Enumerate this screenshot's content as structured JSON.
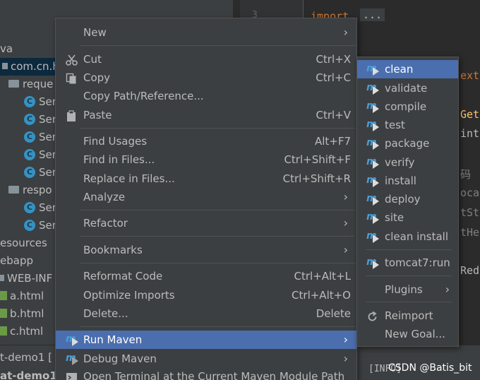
{
  "project_tree": [
    {
      "text": "va",
      "icon": "none"
    },
    {
      "text": "com.cn.h",
      "icon": "package-icon",
      "selected": true
    },
    {
      "text": "reque",
      "icon": "folder-icon"
    },
    {
      "text": "Ser",
      "icon": "class-icon"
    },
    {
      "text": "Ser",
      "icon": "class-icon"
    },
    {
      "text": "Ser",
      "icon": "class-icon"
    },
    {
      "text": "Ser",
      "icon": "class-icon"
    },
    {
      "text": "Ser",
      "icon": "class-icon"
    },
    {
      "text": "respo",
      "icon": "folder-icon"
    },
    {
      "text": "Ser",
      "icon": "class-icon"
    },
    {
      "text": "Ser",
      "icon": "class-icon"
    },
    {
      "text": "esources",
      "icon": "none"
    },
    {
      "text": "ebapp",
      "icon": "none"
    },
    {
      "text": "WEB-INF",
      "icon": "folder-icon"
    },
    {
      "text": "a.html",
      "icon": "html-icon"
    },
    {
      "text": "b.html",
      "icon": "html-icon"
    },
    {
      "text": "c.html",
      "icon": "html-icon"
    }
  ],
  "editor": {
    "line_number": "3",
    "import_kw": "import",
    "fold": "...",
    "fragments": [
      "ext",
      "Get",
      "int",
      "码",
      "oca",
      "tSt",
      "tHe",
      "Red"
    ]
  },
  "bottom": {
    "tab1": "t-demo1 [",
    "tab2": "at-demo1",
    "run_text": "[INFO]",
    "watermark": "CSDN @Batis_bit"
  },
  "context_menu": {
    "new": {
      "label": "New"
    },
    "cut": {
      "label": "Cut",
      "shortcut": "Ctrl+X"
    },
    "copy": {
      "label": "Copy",
      "shortcut": "Ctrl+C"
    },
    "copy_path": {
      "label": "Copy Path/Reference..."
    },
    "paste": {
      "label": "Paste",
      "shortcut": "Ctrl+V"
    },
    "find_usages": {
      "label": "Find Usages",
      "shortcut": "Alt+F7"
    },
    "find_in_files": {
      "label": "Find in Files...",
      "shortcut": "Ctrl+Shift+F"
    },
    "replace_in_files": {
      "label": "Replace in Files...",
      "shortcut": "Ctrl+Shift+R"
    },
    "analyze": {
      "label": "Analyze"
    },
    "refactor": {
      "label": "Refactor"
    },
    "bookmarks": {
      "label": "Bookmarks"
    },
    "reformat": {
      "label": "Reformat Code",
      "shortcut": "Ctrl+Alt+L"
    },
    "optimize": {
      "label": "Optimize Imports",
      "shortcut": "Ctrl+Alt+O"
    },
    "delete": {
      "label": "Delete...",
      "shortcut": "Delete"
    },
    "run_maven": {
      "label": "Run Maven"
    },
    "debug_maven": {
      "label": "Debug Maven"
    },
    "open_terminal": {
      "label": "Open Terminal at the Current Maven Module Path"
    }
  },
  "submenu": {
    "goals": [
      "clean",
      "validate",
      "compile",
      "test",
      "package",
      "verify",
      "install",
      "deploy",
      "site",
      "clean install"
    ],
    "tomcat": "tomcat7:run",
    "plugins": "Plugins",
    "reimport": "Reimport",
    "new_goal": "New Goal..."
  },
  "colors": {
    "menu_bg": "#3c3f41",
    "highlight": "#4b6eaf",
    "text": "#bbbbbb",
    "maven_blue": "#4a9ed8"
  }
}
